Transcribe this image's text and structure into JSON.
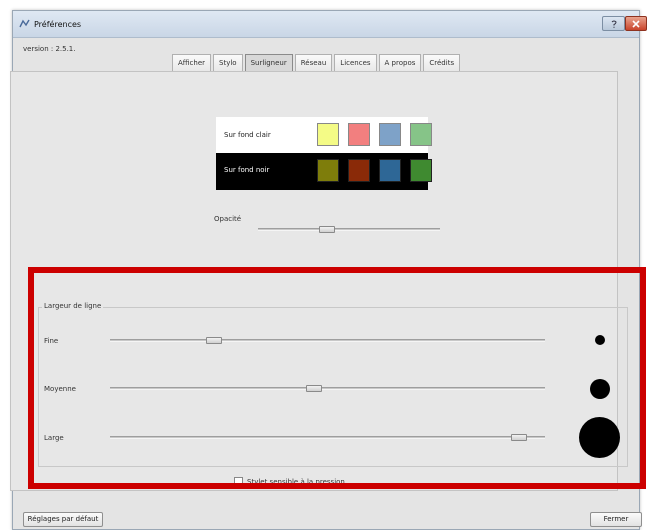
{
  "window": {
    "title": "Préférences",
    "version_text": "version : 2.5.1."
  },
  "tabs": [
    {
      "label": "Afficher",
      "active": false
    },
    {
      "label": "Stylo",
      "active": false
    },
    {
      "label": "Surligneur",
      "active": true
    },
    {
      "label": "Réseau",
      "active": false
    },
    {
      "label": "Licences",
      "active": false
    },
    {
      "label": "A propos",
      "active": false
    },
    {
      "label": "Crédits",
      "active": false
    }
  ],
  "highlighter": {
    "light_row": {
      "label": "Sur fond clair",
      "colors": [
        "#f4fb86",
        "#f27f7f",
        "#7ea2c8",
        "#86c488"
      ]
    },
    "dark_row": {
      "label": "Sur fond noir",
      "colors": [
        "#7e7d0b",
        "#8a2a08",
        "#2e6796",
        "#3f8a30"
      ]
    },
    "opacity": {
      "label": "Opacité",
      "value": 0.38
    }
  },
  "line_width": {
    "group_title": "Largeur de ligne",
    "rows": [
      {
        "label": "Fine",
        "value": 0.24
      },
      {
        "label": "Moyenne",
        "value": 0.47
      },
      {
        "label": "Large",
        "value": 0.94
      }
    ]
  },
  "pressure": {
    "label": "Stylet sensible à la pression",
    "checked": false
  },
  "buttons": {
    "defaults": "Réglages par défaut",
    "close": "Fermer"
  },
  "colors": {
    "highlight_border": "#cc0000"
  }
}
